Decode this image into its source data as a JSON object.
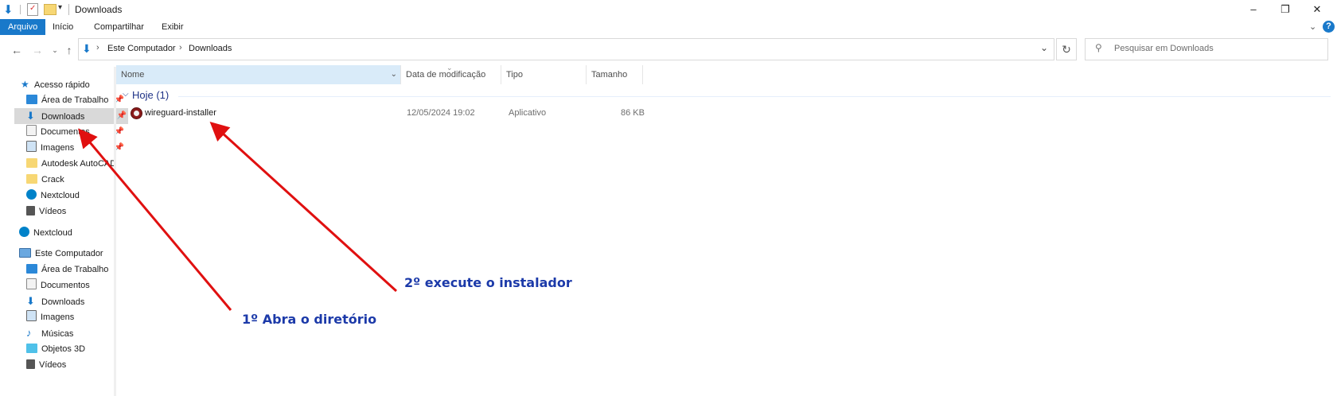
{
  "window": {
    "title": "Downloads",
    "controls": [
      "–",
      "❐",
      "✕"
    ]
  },
  "ribbon": {
    "tabs": [
      "Arquivo",
      "Início",
      "Compartilhar",
      "Exibir"
    ]
  },
  "address": {
    "crumbs": [
      "Este Computador",
      "Downloads"
    ]
  },
  "search": {
    "placeholder": "Pesquisar em Downloads"
  },
  "quick_access": {
    "header": "Acesso rápido",
    "items": [
      "Área de Trabalho",
      "Downloads",
      "Documentos",
      "Imagens",
      "Autodesk AutoCAD",
      "Crack",
      "Nextcloud",
      "Vídeos"
    ]
  },
  "nextcloud_root": "Nextcloud",
  "this_pc": {
    "header": "Este Computador",
    "items": [
      "Área de Trabalho",
      "Documentos",
      "Downloads",
      "Imagens",
      "Músicas",
      "Objetos 3D",
      "Vídeos"
    ]
  },
  "columns": {
    "name": "Nome",
    "date": "Data de modificação",
    "type": "Tipo",
    "size": "Tamanho"
  },
  "group": {
    "label": "Hoje (1)"
  },
  "files": [
    {
      "name": "wireguard-installer",
      "date": "12/05/2024 19:02",
      "type": "Aplicativo",
      "size": "86 KB"
    }
  ],
  "annotations": {
    "step1": "1º Abra o diretório",
    "step2": "2º execute o instalador"
  },
  "colors": {
    "accent": "#1979ca",
    "selection": "#d9d9d9",
    "arrow": "#e01010",
    "annotation_text": "#1c3aa9"
  }
}
